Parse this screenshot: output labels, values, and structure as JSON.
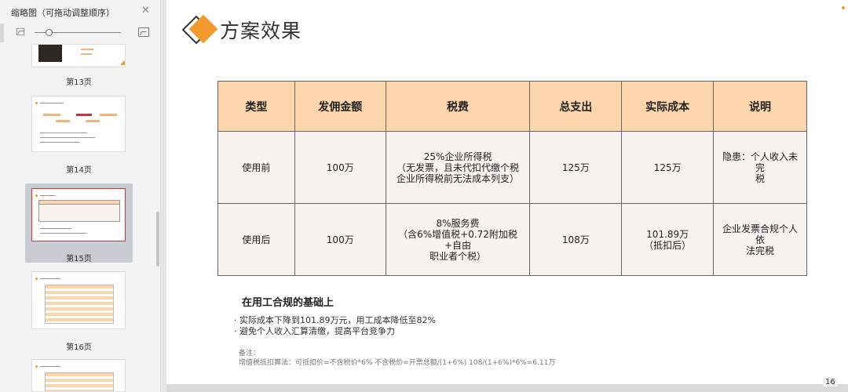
{
  "sidebar": {
    "title": "缩略图（可拖动调整顺序）",
    "thumbnails": [
      {
        "label": "第13页"
      },
      {
        "label": "第14页"
      },
      {
        "label": "第15页"
      },
      {
        "label": "第16页"
      }
    ]
  },
  "slide": {
    "title": "方案效果",
    "page_number": "16",
    "table": {
      "headers": [
        "类型",
        "发佣金额",
        "税费",
        "总支出",
        "实际成本",
        "说明"
      ],
      "rows": [
        {
          "type": "使用前",
          "amount": "100万",
          "tax": [
            "25%企业所得税",
            "（无发票，且未代扣代缴个税",
            "企业所得税前无法成本列支）"
          ],
          "total": "125万",
          "cost": [
            "125万"
          ],
          "note": [
            "隐患：个人收入未完",
            "税"
          ]
        },
        {
          "type": "使用后",
          "amount": "100万",
          "tax": [
            "8%服务费",
            "（含6%增值税+0.72附加税+自由",
            "职业者个税）"
          ],
          "total": "108万",
          "cost": [
            "101.89万",
            "（抵扣后）"
          ],
          "note": [
            "企业发票合规个人依",
            "法完税"
          ]
        }
      ]
    },
    "conclusion_title": "在用工合规的基础上",
    "bullets": [
      "· 实际成本下降到101.89万元，用工成本降低至82%",
      "· 避免个人收入汇算清缴，提高平台竞争力"
    ],
    "remark_label": "备注：",
    "remark_text": "增值税抵扣算法：可抵扣价=不含税价*6%   不含税价=开票总额/(1+6%)   108/(1+6%)*6%=6.11万"
  },
  "colors": {
    "accent": "#f29a2e",
    "table_header": "#fbd6ad",
    "table_cell": "#f8f3ef",
    "active_thumb_border": "#dd3333"
  }
}
